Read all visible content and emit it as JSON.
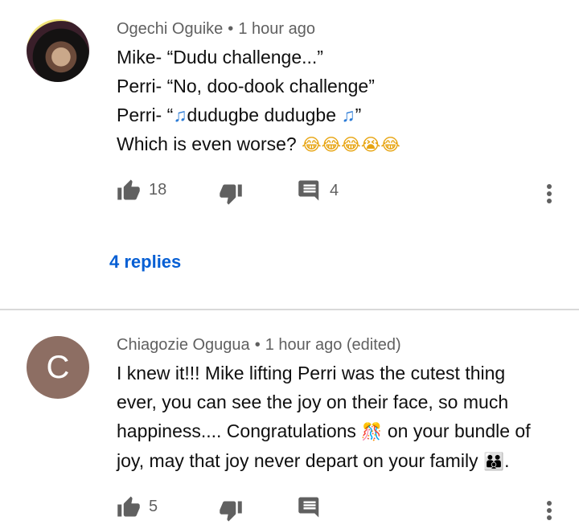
{
  "comments": [
    {
      "author": "Ogechi Oguike",
      "time": "1 hour ago",
      "lines": [
        "Mike- “Dudu challenge...”",
        "Perri- “No, doo-dook challenge”",
        "Perri- “",
        "dudugbe dudugbe ",
        "”",
        "Which is even worse? "
      ],
      "emoji_line4": "😂😂😂😭😂",
      "music_note": "♫",
      "likes": "18",
      "replies_count": "4",
      "replies_link": "4 replies"
    },
    {
      "author": "Chiagozie Ogugua",
      "time": "1 hour ago (edited)",
      "avatar_letter": "C",
      "lines": [
        "I knew it!!! Mike lifting Perri was the cutest thing",
        "ever, you can see the joy on their  face, so much",
        "happiness.... Congratulations ",
        " on your bundle of",
        "joy, may that joy never depart on your family ",
        "."
      ],
      "emoji_congrats": "🎊",
      "emoji_family": "👪",
      "likes": "5"
    }
  ],
  "colors": {
    "link": "#065fd4",
    "meta": "#606060",
    "avatar_c": "#8d6e63",
    "divider": "#d9d9d9"
  },
  "icons": [
    "thumb-up-icon",
    "thumb-down-icon",
    "comment-icon",
    "more-vert-icon"
  ]
}
